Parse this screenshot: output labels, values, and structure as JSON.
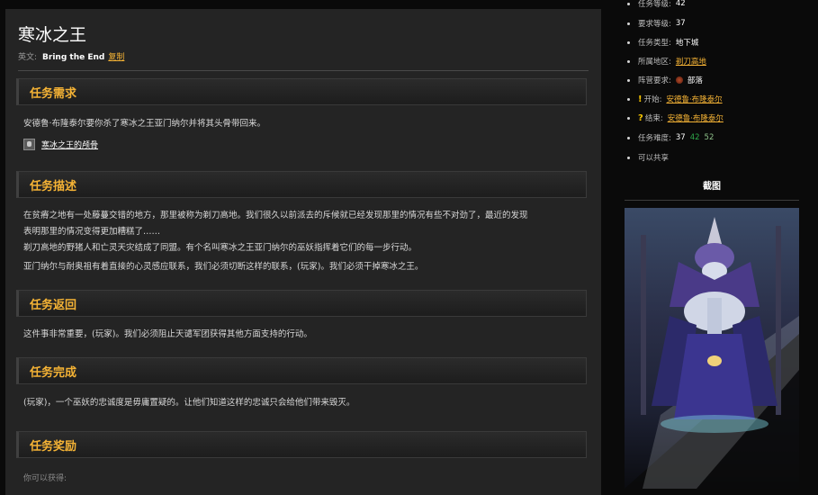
{
  "quest": {
    "title": "寒冰之王",
    "english_label": "英文:",
    "english_name": "Bring the End",
    "copy_label": "复制"
  },
  "sections": {
    "requirements": {
      "heading": "任务需求",
      "text": "安德鲁·布隆泰尔要你杀了寒冰之王亚门纳尔并将其头骨带回来。",
      "item": "寒冰之王的颅骨"
    },
    "description": {
      "heading": "任务描述",
      "line1": "在贫瘠之地有一处藤蔓交错的地方，那里被称为剃刀高地。我们很久以前派去的斥候就已经发现那里的情况有些不对劲了，最近的发现",
      "line2": "表明那里的情况变得更加糟糕了……",
      "line3": "剃刀高地的野猪人和亡灵天灾结成了同盟。有个名叫寒冰之王亚门纳尔的巫妖指挥着它们的每一步行动。",
      "line4": "亚门纳尔与耐奥祖有着直接的心灵感应联系，我们必须切断这样的联系，(玩家)。我们必须干掉寒冰之王。"
    },
    "return": {
      "heading": "任务返回",
      "text": "这件事非常重要，(玩家)。我们必须阻止天谴军团获得其他方面支持的行动。"
    },
    "completion": {
      "heading": "任务完成",
      "text": "(玩家)，一个巫妖的忠诚度是毋庸置疑的。让他们知道这样的忠诚只会给他们带来毁灭。"
    },
    "rewards": {
      "heading": "任务奖励",
      "label": "你可以获得:"
    }
  },
  "sidebar": {
    "quest_level_label": "任务等级:",
    "quest_level": "42",
    "req_level_label": "要求等级:",
    "req_level": "37",
    "type_label": "任务类型:",
    "type": "地下城",
    "zone_label": "所属地区:",
    "zone": "剃刀高地",
    "faction_label": "阵营要求:",
    "faction": "部落",
    "start_label": "开始:",
    "start_npc": "安德鲁·布隆泰尔",
    "end_label": "结束:",
    "end_npc": "安德鲁·布隆泰尔",
    "difficulty_label": "任务难度:",
    "diff1": "37",
    "diff2": "42",
    "diff3": "52",
    "shareable": "可以共享",
    "screenshot_heading": "截图"
  },
  "colors": {
    "accent": "#f5b335",
    "panel": "#242424",
    "page_bg": "#0a0a0a"
  }
}
